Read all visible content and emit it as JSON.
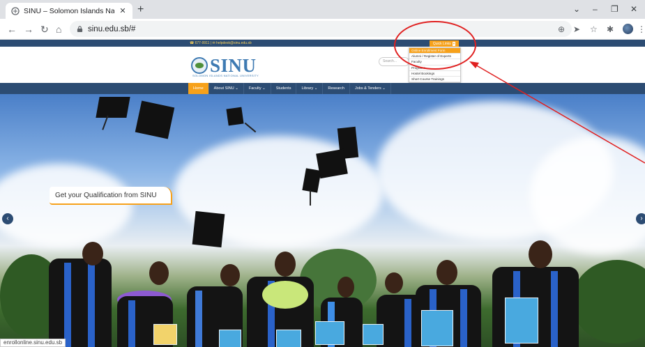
{
  "browser": {
    "tab_title": "SINU – Solomon Islands Nationa",
    "tab_close": "✕",
    "new_tab": "+",
    "url": "sinu.edu.sb/#",
    "status_url": "enrollonline.sinu.edu.sb",
    "controls": {
      "minimize": "–",
      "restore": "❐",
      "close": "✕",
      "menu": "⌄"
    }
  },
  "site": {
    "contact": "☎ 677-9911  |  ✉ helpdesk@sinu.edu.sb",
    "quick_links": "Quick Links",
    "logo_text": "SINU",
    "logo_subtitle": "SOLOMON ISLANDS NATIONAL UNIVERSITY",
    "search_placeholder": "Search...",
    "dropdown": [
      "Online Enrollment Form",
      "Alumni / Register of Experts",
      "Faculty",
      "Programs",
      "Hostel Bookings",
      "Short Course Trainings"
    ],
    "nav": [
      "Home",
      "About SINU ⌄",
      "Faculty ⌄",
      "Students",
      "Library ⌄",
      "Research",
      "Jobs & Tenders ⌄"
    ],
    "hero_caption": "Get your Qualification from SINU",
    "prev": "‹",
    "next": "›"
  },
  "colors": {
    "brand_navy": "#2c4c73",
    "brand_orange": "#f7a11a",
    "logo_blue": "#3e7ab2",
    "annotation_red": "#e02020"
  }
}
